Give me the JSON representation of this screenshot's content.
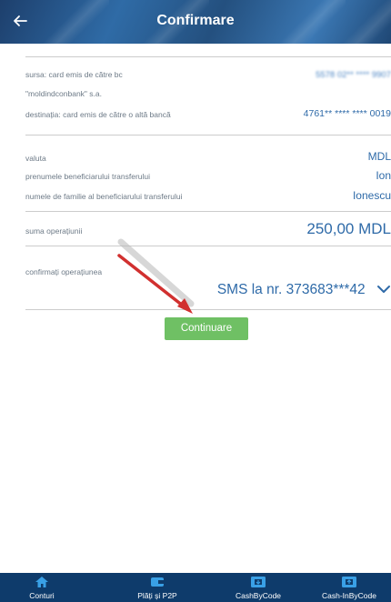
{
  "header": {
    "title": "Confirmare",
    "back_icon": "arrow-left-icon"
  },
  "details": {
    "source_label_line1": "sursa: card  emis de către bc",
    "source_label_line2": "\"moldindconbank\" s.a.",
    "source_value": "5578 02** **** 9907",
    "destination_label": "destinația: card  emis de către o altă bancă",
    "destination_value": "4761** **** **** 0019",
    "currency_label": "valuta",
    "currency_value": "MDL",
    "first_name_label": "prenumele beneficiarului transferului",
    "first_name_value": "Ion",
    "last_name_label": "numele de familie al beneficiarului transferului",
    "last_name_value": "Ionescu",
    "amount_label": "suma operațiunii",
    "amount_value": "250,00 MDL"
  },
  "confirm": {
    "label": "confirmați operațiunea",
    "method_value": "SMS la nr. 373683***42"
  },
  "continue_button": {
    "label": "Continuare"
  },
  "colors": {
    "accent": "#2e6aa8",
    "button": "#6fc064",
    "nav": "#0e3b6b",
    "arrow": "#d1302f"
  },
  "bottom_nav": {
    "items": [
      {
        "label": "Conturi",
        "icon": "home-icon"
      },
      {
        "label": "Plăți și P2P",
        "icon": "wallet-icon"
      },
      {
        "label": "CashByCode",
        "icon": "atm-icon"
      },
      {
        "label": "Cash-InByCode",
        "icon": "atm-deposit-icon"
      }
    ]
  }
}
